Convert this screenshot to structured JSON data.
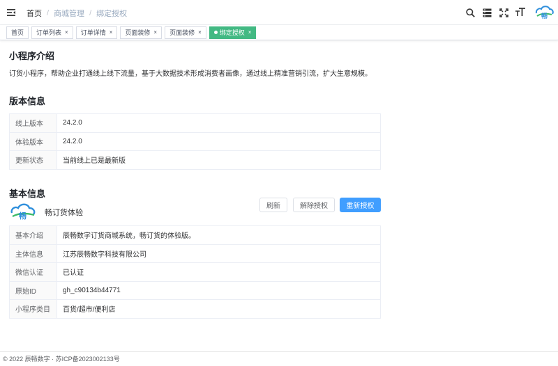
{
  "header": {
    "breadcrumb": [
      "首页",
      "商城管理",
      "绑定授权"
    ],
    "separator": "/",
    "font_size_label": "T"
  },
  "tags": [
    {
      "label": "首页",
      "closable": false,
      "active": false
    },
    {
      "label": "订单列表",
      "closable": true,
      "active": false
    },
    {
      "label": "订单详情",
      "closable": true,
      "active": false
    },
    {
      "label": "页面装修",
      "closable": true,
      "active": false
    },
    {
      "label": "页面装修",
      "closable": true,
      "active": false
    },
    {
      "label": "绑定授权",
      "closable": true,
      "active": true
    }
  ],
  "tag_close_glyph": "×",
  "intro": {
    "title": "小程序介绍",
    "text": "订货小程序，帮助企业打通线上线下流量，基于大数据技术形成消费者画像，通过线上精准营销引流，扩大生意规模。"
  },
  "version": {
    "title": "版本信息",
    "rows": [
      {
        "label": "线上版本",
        "value": "24.2.0"
      },
      {
        "label": "体验版本",
        "value": "24.2.0"
      },
      {
        "label": "更新状态",
        "value": "当前线上已是最新版"
      }
    ]
  },
  "basic": {
    "title": "基本信息",
    "app_name": "畅订货体验",
    "logo_text": "畅",
    "buttons": {
      "refresh": "刷新",
      "unbind": "解除授权",
      "reauth": "重新授权"
    },
    "rows": [
      {
        "label": "基本介绍",
        "value": "辰畅数字订货商城系统，畅订货的体验版。"
      },
      {
        "label": "主体信息",
        "value": "江苏辰畅数字科技有限公司"
      },
      {
        "label": "微信认证",
        "value": "已认证"
      },
      {
        "label": "原始ID",
        "value": "gh_c90134b44771"
      },
      {
        "label": "小程序类目",
        "value": "百货/超市/便利店"
      }
    ]
  },
  "footer": {
    "text": "© 2022 辰畅数字 · 苏ICP备2023002133号"
  },
  "colors": {
    "accent": "#409eff",
    "active_tag": "#42b983",
    "logo_blue": "#2f8fdc",
    "logo_green": "#3dbb6a"
  },
  "icons": [
    "hamburger-icon",
    "search-icon",
    "server-icon",
    "fullscreen-icon",
    "font-size-icon",
    "logo-icon"
  ]
}
